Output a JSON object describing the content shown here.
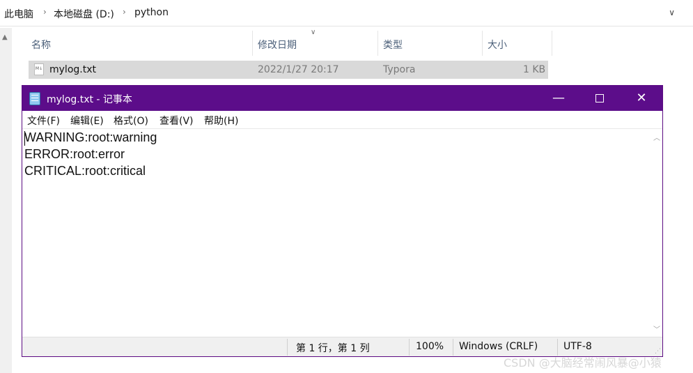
{
  "explorer": {
    "breadcrumb": [
      "此电脑",
      "本地磁盘 (D:)",
      "python"
    ],
    "columns": [
      "名称",
      "修改日期",
      "类型",
      "大小"
    ],
    "file": {
      "name": "mylog.txt",
      "modified": "2022/1/27 20:17",
      "type": "Typora",
      "size": "1 KB"
    }
  },
  "notepad": {
    "title": "mylog.txt - 记事本",
    "menu": [
      "文件(F)",
      "编辑(E)",
      "格式(O)",
      "查看(V)",
      "帮助(H)"
    ],
    "lines": [
      "WARNING:root:warning",
      "ERROR:root:error",
      "CRITICAL:root:critical"
    ],
    "status": {
      "position": "第 1 行，第 1 列",
      "zoom": "100%",
      "line_ending": "Windows (CRLF)",
      "encoding": "UTF-8"
    },
    "title_bar_color": "#5c0d8a"
  },
  "watermark": "CSDN @大脑经常闹风暴@小猿"
}
